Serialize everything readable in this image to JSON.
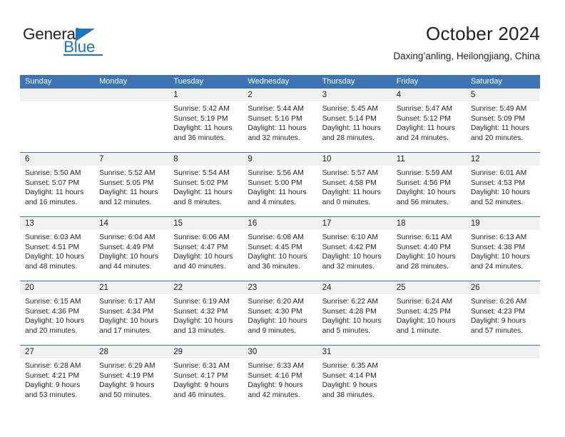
{
  "brand": {
    "name_top": "General",
    "name_bottom": "Blue"
  },
  "header": {
    "title": "October 2024",
    "subtitle": "Daxing’anling, Heilongjiang, China"
  },
  "colors": {
    "header_blue": "#3c74b4",
    "brand_blue": "#1b76bc",
    "daynum_band": "#f0f0f0",
    "text": "#231f20"
  },
  "weekdays": [
    "Sunday",
    "Monday",
    "Tuesday",
    "Wednesday",
    "Thursday",
    "Friday",
    "Saturday"
  ],
  "weeks": [
    [
      {
        "day": "",
        "empty": true
      },
      {
        "day": "",
        "empty": true
      },
      {
        "day": "1",
        "sunrise": "Sunrise: 5:42 AM",
        "sunset": "Sunset: 5:19 PM",
        "daylight1": "Daylight: 11 hours",
        "daylight2": "and 36 minutes."
      },
      {
        "day": "2",
        "sunrise": "Sunrise: 5:44 AM",
        "sunset": "Sunset: 5:16 PM",
        "daylight1": "Daylight: 11 hours",
        "daylight2": "and 32 minutes."
      },
      {
        "day": "3",
        "sunrise": "Sunrise: 5:45 AM",
        "sunset": "Sunset: 5:14 PM",
        "daylight1": "Daylight: 11 hours",
        "daylight2": "and 28 minutes."
      },
      {
        "day": "4",
        "sunrise": "Sunrise: 5:47 AM",
        "sunset": "Sunset: 5:12 PM",
        "daylight1": "Daylight: 11 hours",
        "daylight2": "and 24 minutes."
      },
      {
        "day": "5",
        "sunrise": "Sunrise: 5:49 AM",
        "sunset": "Sunset: 5:09 PM",
        "daylight1": "Daylight: 11 hours",
        "daylight2": "and 20 minutes."
      }
    ],
    [
      {
        "day": "6",
        "sunrise": "Sunrise: 5:50 AM",
        "sunset": "Sunset: 5:07 PM",
        "daylight1": "Daylight: 11 hours",
        "daylight2": "and 16 minutes."
      },
      {
        "day": "7",
        "sunrise": "Sunrise: 5:52 AM",
        "sunset": "Sunset: 5:05 PM",
        "daylight1": "Daylight: 11 hours",
        "daylight2": "and 12 minutes."
      },
      {
        "day": "8",
        "sunrise": "Sunrise: 5:54 AM",
        "sunset": "Sunset: 5:02 PM",
        "daylight1": "Daylight: 11 hours",
        "daylight2": "and 8 minutes."
      },
      {
        "day": "9",
        "sunrise": "Sunrise: 5:56 AM",
        "sunset": "Sunset: 5:00 PM",
        "daylight1": "Daylight: 11 hours",
        "daylight2": "and 4 minutes."
      },
      {
        "day": "10",
        "sunrise": "Sunrise: 5:57 AM",
        "sunset": "Sunset: 4:58 PM",
        "daylight1": "Daylight: 11 hours",
        "daylight2": "and 0 minutes."
      },
      {
        "day": "11",
        "sunrise": "Sunrise: 5:59 AM",
        "sunset": "Sunset: 4:56 PM",
        "daylight1": "Daylight: 10 hours",
        "daylight2": "and 56 minutes."
      },
      {
        "day": "12",
        "sunrise": "Sunrise: 6:01 AM",
        "sunset": "Sunset: 4:53 PM",
        "daylight1": "Daylight: 10 hours",
        "daylight2": "and 52 minutes."
      }
    ],
    [
      {
        "day": "13",
        "sunrise": "Sunrise: 6:03 AM",
        "sunset": "Sunset: 4:51 PM",
        "daylight1": "Daylight: 10 hours",
        "daylight2": "and 48 minutes."
      },
      {
        "day": "14",
        "sunrise": "Sunrise: 6:04 AM",
        "sunset": "Sunset: 4:49 PM",
        "daylight1": "Daylight: 10 hours",
        "daylight2": "and 44 minutes."
      },
      {
        "day": "15",
        "sunrise": "Sunrise: 6:06 AM",
        "sunset": "Sunset: 4:47 PM",
        "daylight1": "Daylight: 10 hours",
        "daylight2": "and 40 minutes."
      },
      {
        "day": "16",
        "sunrise": "Sunrise: 6:08 AM",
        "sunset": "Sunset: 4:45 PM",
        "daylight1": "Daylight: 10 hours",
        "daylight2": "and 36 minutes."
      },
      {
        "day": "17",
        "sunrise": "Sunrise: 6:10 AM",
        "sunset": "Sunset: 4:42 PM",
        "daylight1": "Daylight: 10 hours",
        "daylight2": "and 32 minutes."
      },
      {
        "day": "18",
        "sunrise": "Sunrise: 6:11 AM",
        "sunset": "Sunset: 4:40 PM",
        "daylight1": "Daylight: 10 hours",
        "daylight2": "and 28 minutes."
      },
      {
        "day": "19",
        "sunrise": "Sunrise: 6:13 AM",
        "sunset": "Sunset: 4:38 PM",
        "daylight1": "Daylight: 10 hours",
        "daylight2": "and 24 minutes."
      }
    ],
    [
      {
        "day": "20",
        "sunrise": "Sunrise: 6:15 AM",
        "sunset": "Sunset: 4:36 PM",
        "daylight1": "Daylight: 10 hours",
        "daylight2": "and 20 minutes."
      },
      {
        "day": "21",
        "sunrise": "Sunrise: 6:17 AM",
        "sunset": "Sunset: 4:34 PM",
        "daylight1": "Daylight: 10 hours",
        "daylight2": "and 17 minutes."
      },
      {
        "day": "22",
        "sunrise": "Sunrise: 6:19 AM",
        "sunset": "Sunset: 4:32 PM",
        "daylight1": "Daylight: 10 hours",
        "daylight2": "and 13 minutes."
      },
      {
        "day": "23",
        "sunrise": "Sunrise: 6:20 AM",
        "sunset": "Sunset: 4:30 PM",
        "daylight1": "Daylight: 10 hours",
        "daylight2": "and 9 minutes."
      },
      {
        "day": "24",
        "sunrise": "Sunrise: 6:22 AM",
        "sunset": "Sunset: 4:28 PM",
        "daylight1": "Daylight: 10 hours",
        "daylight2": "and 5 minutes."
      },
      {
        "day": "25",
        "sunrise": "Sunrise: 6:24 AM",
        "sunset": "Sunset: 4:25 PM",
        "daylight1": "Daylight: 10 hours",
        "daylight2": "and 1 minute."
      },
      {
        "day": "26",
        "sunrise": "Sunrise: 6:26 AM",
        "sunset": "Sunset: 4:23 PM",
        "daylight1": "Daylight: 9 hours",
        "daylight2": "and 57 minutes."
      }
    ],
    [
      {
        "day": "27",
        "sunrise": "Sunrise: 6:28 AM",
        "sunset": "Sunset: 4:21 PM",
        "daylight1": "Daylight: 9 hours",
        "daylight2": "and 53 minutes."
      },
      {
        "day": "28",
        "sunrise": "Sunrise: 6:29 AM",
        "sunset": "Sunset: 4:19 PM",
        "daylight1": "Daylight: 9 hours",
        "daylight2": "and 50 minutes."
      },
      {
        "day": "29",
        "sunrise": "Sunrise: 6:31 AM",
        "sunset": "Sunset: 4:17 PM",
        "daylight1": "Daylight: 9 hours",
        "daylight2": "and 46 minutes."
      },
      {
        "day": "30",
        "sunrise": "Sunrise: 6:33 AM",
        "sunset": "Sunset: 4:16 PM",
        "daylight1": "Daylight: 9 hours",
        "daylight2": "and 42 minutes."
      },
      {
        "day": "31",
        "sunrise": "Sunrise: 6:35 AM",
        "sunset": "Sunset: 4:14 PM",
        "daylight1": "Daylight: 9 hours",
        "daylight2": "and 38 minutes."
      },
      {
        "day": "",
        "empty": true
      },
      {
        "day": "",
        "empty": true
      }
    ]
  ]
}
